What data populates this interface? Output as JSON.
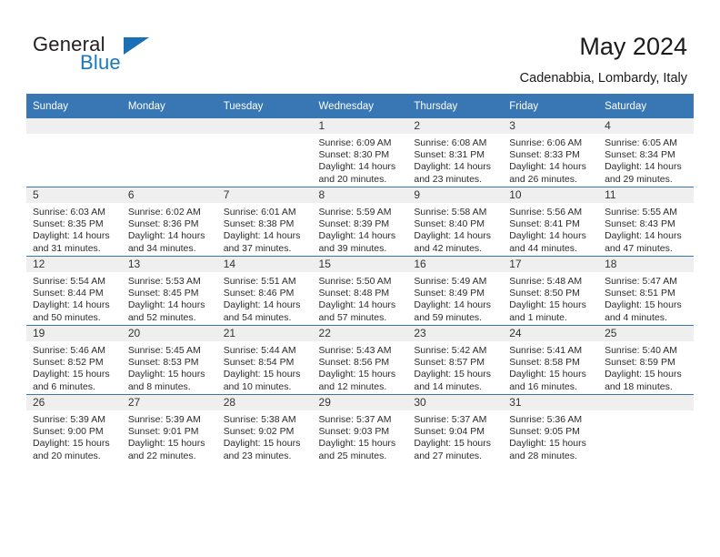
{
  "brand": {
    "name_top": "General",
    "name_bottom": "Blue",
    "accent_color": "#1a6fb5"
  },
  "header": {
    "title": "May 2024",
    "subtitle": "Cadenabbia, Lombardy, Italy"
  },
  "calendar": {
    "header_bg": "#3876b4",
    "daynum_bg": "#efefef",
    "weekdays": [
      "Sunday",
      "Monday",
      "Tuesday",
      "Wednesday",
      "Thursday",
      "Friday",
      "Saturday"
    ],
    "weeks": [
      [
        {
          "day": "",
          "empty": true
        },
        {
          "day": "",
          "empty": true
        },
        {
          "day": "",
          "empty": true
        },
        {
          "day": "1",
          "sunrise": "Sunrise: 6:09 AM",
          "sunset": "Sunset: 8:30 PM",
          "daylight": "Daylight: 14 hours and 20 minutes."
        },
        {
          "day": "2",
          "sunrise": "Sunrise: 6:08 AM",
          "sunset": "Sunset: 8:31 PM",
          "daylight": "Daylight: 14 hours and 23 minutes."
        },
        {
          "day": "3",
          "sunrise": "Sunrise: 6:06 AM",
          "sunset": "Sunset: 8:33 PM",
          "daylight": "Daylight: 14 hours and 26 minutes."
        },
        {
          "day": "4",
          "sunrise": "Sunrise: 6:05 AM",
          "sunset": "Sunset: 8:34 PM",
          "daylight": "Daylight: 14 hours and 29 minutes."
        }
      ],
      [
        {
          "day": "5",
          "sunrise": "Sunrise: 6:03 AM",
          "sunset": "Sunset: 8:35 PM",
          "daylight": "Daylight: 14 hours and 31 minutes."
        },
        {
          "day": "6",
          "sunrise": "Sunrise: 6:02 AM",
          "sunset": "Sunset: 8:36 PM",
          "daylight": "Daylight: 14 hours and 34 minutes."
        },
        {
          "day": "7",
          "sunrise": "Sunrise: 6:01 AM",
          "sunset": "Sunset: 8:38 PM",
          "daylight": "Daylight: 14 hours and 37 minutes."
        },
        {
          "day": "8",
          "sunrise": "Sunrise: 5:59 AM",
          "sunset": "Sunset: 8:39 PM",
          "daylight": "Daylight: 14 hours and 39 minutes."
        },
        {
          "day": "9",
          "sunrise": "Sunrise: 5:58 AM",
          "sunset": "Sunset: 8:40 PM",
          "daylight": "Daylight: 14 hours and 42 minutes."
        },
        {
          "day": "10",
          "sunrise": "Sunrise: 5:56 AM",
          "sunset": "Sunset: 8:41 PM",
          "daylight": "Daylight: 14 hours and 44 minutes."
        },
        {
          "day": "11",
          "sunrise": "Sunrise: 5:55 AM",
          "sunset": "Sunset: 8:43 PM",
          "daylight": "Daylight: 14 hours and 47 minutes."
        }
      ],
      [
        {
          "day": "12",
          "sunrise": "Sunrise: 5:54 AM",
          "sunset": "Sunset: 8:44 PM",
          "daylight": "Daylight: 14 hours and 50 minutes."
        },
        {
          "day": "13",
          "sunrise": "Sunrise: 5:53 AM",
          "sunset": "Sunset: 8:45 PM",
          "daylight": "Daylight: 14 hours and 52 minutes."
        },
        {
          "day": "14",
          "sunrise": "Sunrise: 5:51 AM",
          "sunset": "Sunset: 8:46 PM",
          "daylight": "Daylight: 14 hours and 54 minutes."
        },
        {
          "day": "15",
          "sunrise": "Sunrise: 5:50 AM",
          "sunset": "Sunset: 8:48 PM",
          "daylight": "Daylight: 14 hours and 57 minutes."
        },
        {
          "day": "16",
          "sunrise": "Sunrise: 5:49 AM",
          "sunset": "Sunset: 8:49 PM",
          "daylight": "Daylight: 14 hours and 59 minutes."
        },
        {
          "day": "17",
          "sunrise": "Sunrise: 5:48 AM",
          "sunset": "Sunset: 8:50 PM",
          "daylight": "Daylight: 15 hours and 1 minute."
        },
        {
          "day": "18",
          "sunrise": "Sunrise: 5:47 AM",
          "sunset": "Sunset: 8:51 PM",
          "daylight": "Daylight: 15 hours and 4 minutes."
        }
      ],
      [
        {
          "day": "19",
          "sunrise": "Sunrise: 5:46 AM",
          "sunset": "Sunset: 8:52 PM",
          "daylight": "Daylight: 15 hours and 6 minutes."
        },
        {
          "day": "20",
          "sunrise": "Sunrise: 5:45 AM",
          "sunset": "Sunset: 8:53 PM",
          "daylight": "Daylight: 15 hours and 8 minutes."
        },
        {
          "day": "21",
          "sunrise": "Sunrise: 5:44 AM",
          "sunset": "Sunset: 8:54 PM",
          "daylight": "Daylight: 15 hours and 10 minutes."
        },
        {
          "day": "22",
          "sunrise": "Sunrise: 5:43 AM",
          "sunset": "Sunset: 8:56 PM",
          "daylight": "Daylight: 15 hours and 12 minutes."
        },
        {
          "day": "23",
          "sunrise": "Sunrise: 5:42 AM",
          "sunset": "Sunset: 8:57 PM",
          "daylight": "Daylight: 15 hours and 14 minutes."
        },
        {
          "day": "24",
          "sunrise": "Sunrise: 5:41 AM",
          "sunset": "Sunset: 8:58 PM",
          "daylight": "Daylight: 15 hours and 16 minutes."
        },
        {
          "day": "25",
          "sunrise": "Sunrise: 5:40 AM",
          "sunset": "Sunset: 8:59 PM",
          "daylight": "Daylight: 15 hours and 18 minutes."
        }
      ],
      [
        {
          "day": "26",
          "sunrise": "Sunrise: 5:39 AM",
          "sunset": "Sunset: 9:00 PM",
          "daylight": "Daylight: 15 hours and 20 minutes."
        },
        {
          "day": "27",
          "sunrise": "Sunrise: 5:39 AM",
          "sunset": "Sunset: 9:01 PM",
          "daylight": "Daylight: 15 hours and 22 minutes."
        },
        {
          "day": "28",
          "sunrise": "Sunrise: 5:38 AM",
          "sunset": "Sunset: 9:02 PM",
          "daylight": "Daylight: 15 hours and 23 minutes."
        },
        {
          "day": "29",
          "sunrise": "Sunrise: 5:37 AM",
          "sunset": "Sunset: 9:03 PM",
          "daylight": "Daylight: 15 hours and 25 minutes."
        },
        {
          "day": "30",
          "sunrise": "Sunrise: 5:37 AM",
          "sunset": "Sunset: 9:04 PM",
          "daylight": "Daylight: 15 hours and 27 minutes."
        },
        {
          "day": "31",
          "sunrise": "Sunrise: 5:36 AM",
          "sunset": "Sunset: 9:05 PM",
          "daylight": "Daylight: 15 hours and 28 minutes."
        },
        {
          "day": "",
          "empty": true
        }
      ]
    ]
  }
}
